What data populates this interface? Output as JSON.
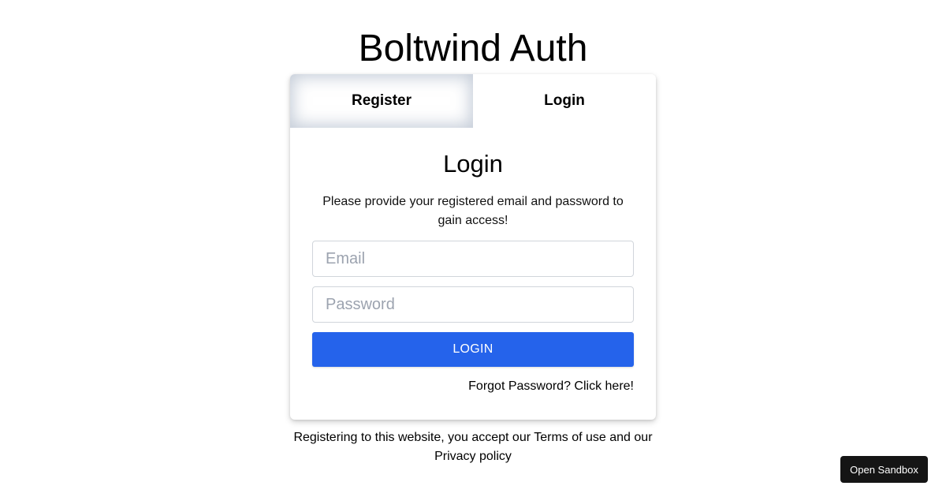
{
  "app": {
    "title": "Boltwind Auth"
  },
  "tabs": [
    {
      "label": "Register",
      "active": false
    },
    {
      "label": "Login",
      "active": true
    }
  ],
  "login_form": {
    "heading": "Login",
    "description": "Please provide your registered email and password to gain access!",
    "email_placeholder": "Email",
    "email_value": "",
    "password_placeholder": "Password",
    "password_value": "",
    "submit_label": "LOGIN",
    "forgot_link": "Forgot Password? Click here!"
  },
  "footer": {
    "prefix": "Registering to this website, you accept our ",
    "terms_link": "Terms of use",
    "middle": " and our ",
    "privacy_link": "Privacy policy"
  },
  "sandbox_button": "Open Sandbox",
  "colors": {
    "primary": "#2563eb",
    "sandbox_bg": "#151515",
    "inactive_tab_shadow": "#94a3b8"
  }
}
